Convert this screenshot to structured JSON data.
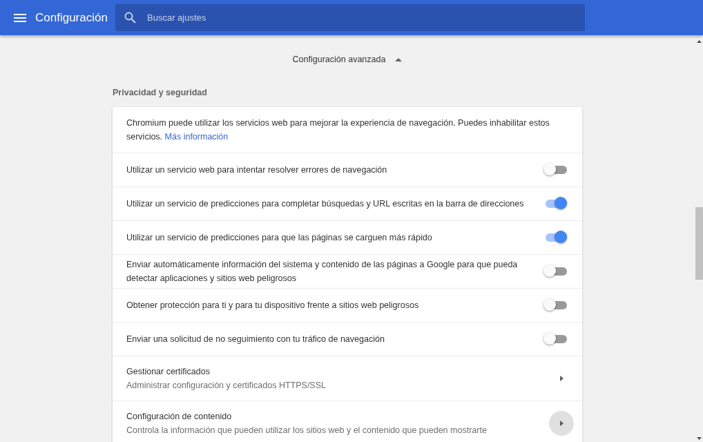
{
  "header": {
    "title": "Configuración",
    "search": {
      "placeholder": "Buscar ajustes"
    }
  },
  "advanced": {
    "label": "Configuración avanzada",
    "expanded": true
  },
  "section": {
    "title": "Privacidad y seguridad",
    "intro": {
      "text": "Chromium puede utilizar los servicios web para mejorar la experiencia de navegación. Puedes inhabilitar estos servicios.",
      "link": "Más información"
    },
    "rows": [
      {
        "kind": "toggle",
        "label": "Utilizar un servicio web para intentar resolver errores de navegación",
        "on": false
      },
      {
        "kind": "toggle",
        "label": "Utilizar un servicio de predicciones para completar búsquedas y URL escritas en la barra de direcciones",
        "on": true
      },
      {
        "kind": "toggle",
        "label": "Utilizar un servicio de predicciones para que las páginas se carguen más rápido",
        "on": true
      },
      {
        "kind": "toggle",
        "label": "Enviar automáticamente información del sistema y contenido de las páginas a Google para que pueda detectar aplicaciones y sitios web peligrosos",
        "on": false
      },
      {
        "kind": "toggle",
        "label": "Obtener protección para ti y para tu dispositivo frente a sitios web peligrosos",
        "on": false
      },
      {
        "kind": "toggle",
        "label": "Enviar una solicitud de no seguimiento con tu tráfico de navegación",
        "on": false
      },
      {
        "kind": "link",
        "label": "Gestionar certificados",
        "sublabel": "Administrar configuración y certificados HTTPS/SSL",
        "hovered": false
      },
      {
        "kind": "link",
        "label": "Configuración de contenido",
        "sublabel": "Controla la información que pueden utilizar los sitios web y el contenido que pueden mostrarte",
        "hovered": true
      }
    ]
  }
}
